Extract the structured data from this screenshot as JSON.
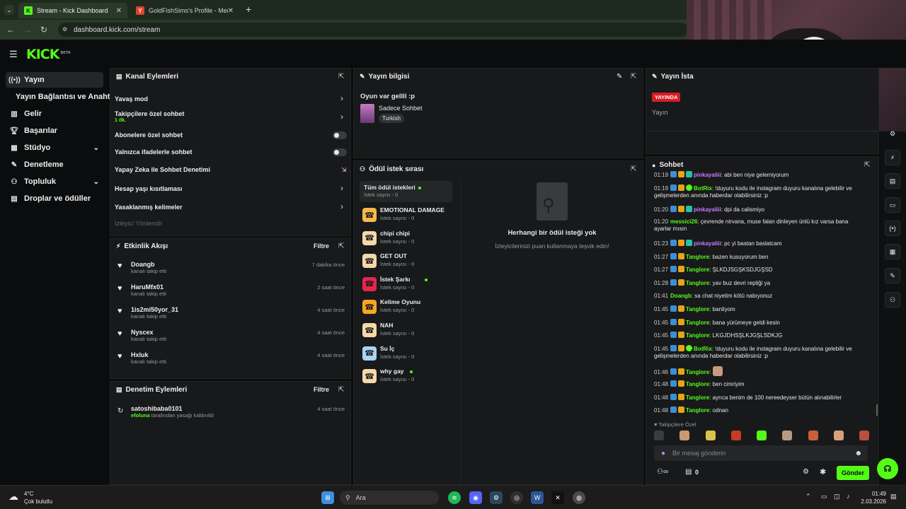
{
  "browser": {
    "tabs": [
      {
        "title": "Stream - Kick Dashboard"
      },
      {
        "title": "GoldFishSims's Profile - Memb"
      }
    ],
    "new_tab": "+",
    "url": "dashboard.kick.com/stream"
  },
  "brand": {
    "logo": "KICK",
    "beta": "BETA",
    "accent": "#53fc18"
  },
  "sidebar": {
    "items": [
      {
        "label": "Yayın",
        "icon": "broadcast-icon"
      },
      {
        "label": "Yayın Bağlantısı ve Anahtarı"
      },
      {
        "label": "Gelir",
        "icon": "chart-icon"
      },
      {
        "label": "Başarılar",
        "icon": "trophy-icon"
      },
      {
        "label": "Stüdyo",
        "icon": "layout-icon"
      },
      {
        "label": "Denetleme",
        "icon": "wrench-icon"
      },
      {
        "label": "Topluluk",
        "icon": "people-icon"
      },
      {
        "label": "Droplar ve ödüller",
        "icon": "gift-icon"
      }
    ]
  },
  "channel_actions": {
    "title": "Kanal Eylemleri",
    "rows": [
      {
        "label": "Yavaş mod"
      },
      {
        "label": "Takipçilere özel sohbet",
        "sub": "1 dk."
      },
      {
        "label": "Abonelere özel sohbet"
      },
      {
        "label": "Yalnızca ifadelerle sohbet"
      },
      {
        "label": "Yapay Zeka ile Sohbet Denetimi"
      },
      {
        "label": "Hesap yaşı kısıtlaması"
      },
      {
        "label": "Yasaklanmış kelimeler"
      },
      {
        "label": "İzleyici Yönlendir"
      }
    ]
  },
  "stream_info": {
    "title": "Yayın bilgisi",
    "stream_title": "Oyun var gellll :p",
    "category": "Sadece Sohbet",
    "tag": "Turkish"
  },
  "live_panel": {
    "title": "Yayın İsta",
    "badge": "YAYINDA",
    "label": "Yayın"
  },
  "activity_feed": {
    "title": "Etkinlik Akışı",
    "filter": "Filtre",
    "items": [
      {
        "user": "Doangb",
        "action": "kanalı takip etti",
        "time": "7 dakika önce"
      },
      {
        "user": "HaruMfx01",
        "action": "kanalı takip etti",
        "time": "2 saat önce"
      },
      {
        "user": "1is2mi50yor_31",
        "action": "kanalı takip etti",
        "time": "4 saat önce"
      },
      {
        "user": "Nyscex",
        "action": "kanalı takip etti",
        "time": "4 saat önce"
      },
      {
        "user": "Hxluk",
        "action": "kanalı takip etti",
        "time": "4 saat önce"
      }
    ]
  },
  "mod_actions": {
    "title": "Denetim Eylemleri",
    "filter": "Filtre",
    "items": [
      {
        "user": "satoshibaba0101",
        "by": "efoluna",
        "action": "tarafından yasağı kaldırıldı",
        "time": "4 saat önce"
      }
    ]
  },
  "reward_queue": {
    "title": "Ödül istek sırası",
    "all": {
      "label": "Tüm ödül istekleri",
      "count": "İstek sayısı - 0"
    },
    "rewards": [
      {
        "name": "EMOTIONAL DAMAGE",
        "count": "İstek sayısı - 0",
        "color": "#f5b94a",
        "dot": false
      },
      {
        "name": "chipi chipi",
        "count": "İstek sayısı - 0",
        "color": "#f5d8a8",
        "dot": false
      },
      {
        "name": "GET OUT",
        "count": "İstek sayısı - 0",
        "color": "#f5d8a8",
        "dot": false
      },
      {
        "name": "İstek Şarkı",
        "count": "İstek sayısı - 0",
        "color": "#e6244f",
        "dot": true
      },
      {
        "name": "Kelime Oyunu",
        "count": "İstek sayısı - 0",
        "color": "#f5a623",
        "dot": false
      },
      {
        "name": "NAH",
        "count": "İstek sayısı - 0",
        "color": "#f5d8a8",
        "dot": false
      },
      {
        "name": "Su İç",
        "count": "İstek sayısı - 0",
        "color": "#a8d4f5",
        "dot": false
      },
      {
        "name": "why gay",
        "count": "İstek sayısı - 0",
        "color": "#f5d8a8",
        "dot": true
      }
    ],
    "empty_title": "Herhangi bir ödül isteği yok",
    "empty_sub": "İzleyicilerinizi puan kullanmaya teşvik edin!"
  },
  "chat": {
    "title": "Sohbet",
    "messages": [
      {
        "time": "01:19",
        "user": "pinkayaliii",
        "color": "#c77dff",
        "text": "abi ben niye gelemiyorum",
        "badges": [
          "b1",
          "b2",
          "b3"
        ]
      },
      {
        "time": "01:19",
        "user": "BotRix",
        "color": "#53fc18",
        "text": "!duyuru kodu ile instagram duyuru kanalına gelebilir ve gelişmelerden anında haberdar olabilirsiniz :p",
        "badges": [
          "b1",
          "b2",
          "b4"
        ]
      },
      {
        "time": "01:20",
        "user": "pinkayaliii",
        "color": "#c77dff",
        "text": "dpi da calismiyo",
        "badges": [
          "b1",
          "b2",
          "b3"
        ]
      },
      {
        "time": "01:20",
        "user": "messici26",
        "color": "#53fc18",
        "text": "çevrende nirvana, muse falan dinleyen ünlü kız varsa bana ayarlar mısın",
        "badges": []
      },
      {
        "time": "01:23",
        "user": "pinkayaliii",
        "color": "#c77dff",
        "text": "pc yi bastan baslatcam",
        "badges": [
          "b1",
          "b2",
          "b3"
        ]
      },
      {
        "time": "01:27",
        "user": "Tanglore",
        "color": "#53fc18",
        "text": "bazen kusuyorum ben",
        "badges": [
          "b1",
          "b2"
        ]
      },
      {
        "time": "01:27",
        "user": "Tanglore",
        "color": "#53fc18",
        "text": "ŞLKDJSGŞKSDJGŞSD",
        "badges": [
          "b1",
          "b2"
        ]
      },
      {
        "time": "01:28",
        "user": "Tanglore",
        "color": "#53fc18",
        "text": "yav buz devri repliği ya",
        "badges": [
          "b1",
          "b2"
        ]
      },
      {
        "time": "01:41",
        "user": "Doangb",
        "color": "#53fc18",
        "text": "sa chat niyetim kötü nabıyonuz",
        "badges": []
      },
      {
        "time": "01:45",
        "user": "Tanglore",
        "color": "#53fc18",
        "text": "banliyom",
        "badges": [
          "b1",
          "b2"
        ]
      },
      {
        "time": "01:45",
        "user": "Tanglore",
        "color": "#53fc18",
        "text": "bana yürümeye geldi kesin",
        "badges": [
          "b1",
          "b2"
        ]
      },
      {
        "time": "01:45",
        "user": "Tanglore",
        "color": "#53fc18",
        "text": "LKGJDHSŞLKJGŞLSDKJG",
        "badges": [
          "b1",
          "b2"
        ]
      },
      {
        "time": "01:45",
        "user": "BotRix",
        "color": "#53fc18",
        "text": "!duyuru kodu ile instagram duyuru kanalına gelebilir ve gelişmelerden anında haberdar olabilirsiniz :p",
        "badges": [
          "b1",
          "b2",
          "b4"
        ]
      },
      {
        "time": "01:46",
        "user": "Tanglore",
        "color": "#53fc18",
        "text": "",
        "badges": [
          "b1",
          "b2"
        ],
        "emote": true
      },
      {
        "time": "01:48",
        "user": "Tanglore",
        "color": "#53fc18",
        "text": "ben cimriyim",
        "badges": [
          "b1",
          "b2"
        ]
      },
      {
        "time": "01:48",
        "user": "Tanglore",
        "color": "#53fc18",
        "text": "ayrıca benim de 100 nereedeyser bütün alınabilirler",
        "badges": [
          "b1",
          "b2"
        ]
      },
      {
        "time": "01:48",
        "user": "Tanglore",
        "color": "#53fc18",
        "text": "odnan",
        "badges": [
          "b1",
          "b2"
        ]
      }
    ],
    "follower_only": "Takipçilere Özel",
    "input_placeholder": "Bir mesaj gönderin",
    "viewer_count": "0",
    "send": "Gönder"
  },
  "taskbar": {
    "weather_temp": "4°C",
    "weather_desc": "Çok bulutlu",
    "search": "Ara",
    "time": "01:49",
    "date": "2.03.2026"
  }
}
